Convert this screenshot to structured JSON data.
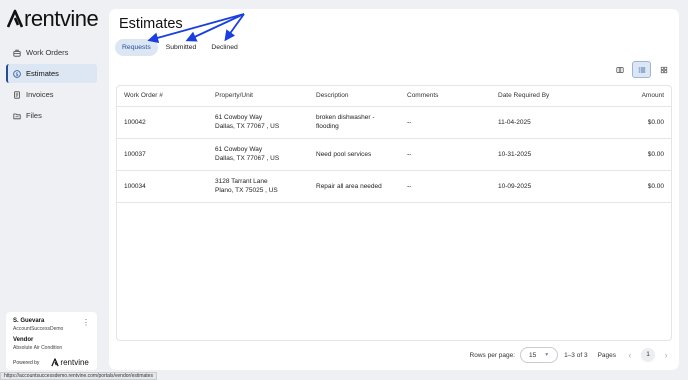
{
  "brand": {
    "name": "rentvine"
  },
  "sidebar": {
    "items": [
      {
        "label": "Work Orders",
        "icon": "toolbox-icon",
        "active": false
      },
      {
        "label": "Estimates",
        "icon": "dollar-circle-icon",
        "active": true
      },
      {
        "label": "Invoices",
        "icon": "receipt-icon",
        "active": false
      },
      {
        "label": "Files",
        "icon": "folder-icon",
        "active": false
      }
    ]
  },
  "user": {
    "name": "S. Guevara",
    "account": "AccountSuccessDemo",
    "role": "Vendor",
    "company": "Absolute Air Condition",
    "powered_by": "Powered by",
    "powered_brand": "rentvine"
  },
  "page": {
    "title": "Estimates"
  },
  "tabs": [
    {
      "label": "Requests",
      "active": true
    },
    {
      "label": "Submitted",
      "active": false
    },
    {
      "label": "Declined",
      "active": false
    }
  ],
  "view_toggle": [
    "columns-view-icon",
    "list-view-icon",
    "grid-view-icon"
  ],
  "table": {
    "headers": [
      "Work Order #",
      "Property/Unit",
      "Description",
      "Comments",
      "Date Required By",
      "Amount"
    ],
    "rows": [
      {
        "work_order": "100042",
        "address1": "61 Cowboy Way",
        "address2": "Dallas, TX 77067 , US",
        "desc1": "broken dishwasher -",
        "desc2": "flooding",
        "comments": "--",
        "date": "11-04-2025",
        "amount": "$0.00"
      },
      {
        "work_order": "100037",
        "address1": "61 Cowboy Way",
        "address2": "Dallas, TX 77067 , US",
        "desc1": "Need pool services",
        "desc2": "",
        "comments": "--",
        "date": "10-31-2025",
        "amount": "$0.00"
      },
      {
        "work_order": "100034",
        "address1": "3128 Tarrant Lane",
        "address2": "Plano, TX 75025 , US",
        "desc1": "Repair all area needed",
        "desc2": "",
        "comments": "--",
        "date": "10-09-2025",
        "amount": "$0.00"
      }
    ]
  },
  "pagination": {
    "rows_label": "Rows per page:",
    "rows_value": "15",
    "count": "1–3 of 3",
    "pages_label": "Pages",
    "current_page": "1"
  },
  "status_url": "https://accountsuccessdemo.rentvine.com/portals/vendor/estimates",
  "colors": {
    "accent": "#1f4f99",
    "active_bg": "#dde6f3",
    "annotation_arrow": "#1a3fe0"
  }
}
